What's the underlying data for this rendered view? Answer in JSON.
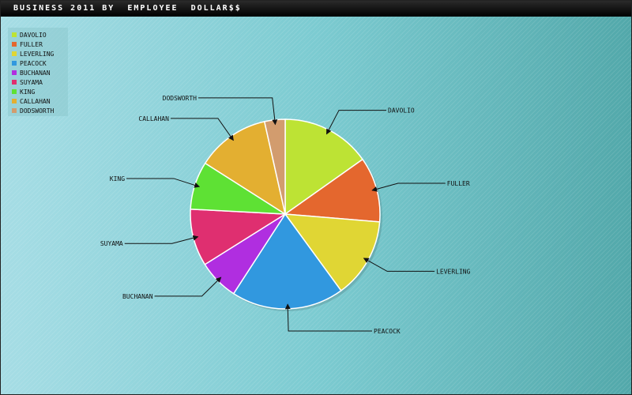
{
  "window": {
    "title": "BUSINESS 2011 BY  EMPLOYEE  DOLLAR$$"
  },
  "chart_data": {
    "type": "pie",
    "title": "BUSINESS 2011 BY  EMPLOYEE  DOLLAR$$",
    "legend_position": "top-left",
    "slices": [
      {
        "label": "DAVOLIO",
        "value": 15.6,
        "color": "#bde334"
      },
      {
        "label": "FULLER",
        "value": 11.4,
        "color": "#e4672e"
      },
      {
        "label": "LEVERLING",
        "value": 14.0,
        "color": "#e0d634"
      },
      {
        "label": "PEACOCK",
        "value": 19.7,
        "color": "#3198df"
      },
      {
        "label": "BUCHANAN",
        "value": 7.1,
        "color": "#b02ee0"
      },
      {
        "label": "SUYAMA",
        "value": 10.0,
        "color": "#df2f70"
      },
      {
        "label": "KING",
        "value": 8.4,
        "color": "#5ee134"
      },
      {
        "label": "CALLAHAN",
        "value": 12.8,
        "color": "#e3af31"
      },
      {
        "label": "DODSWORTH",
        "value": 3.6,
        "color": "#d29c6e"
      }
    ]
  }
}
